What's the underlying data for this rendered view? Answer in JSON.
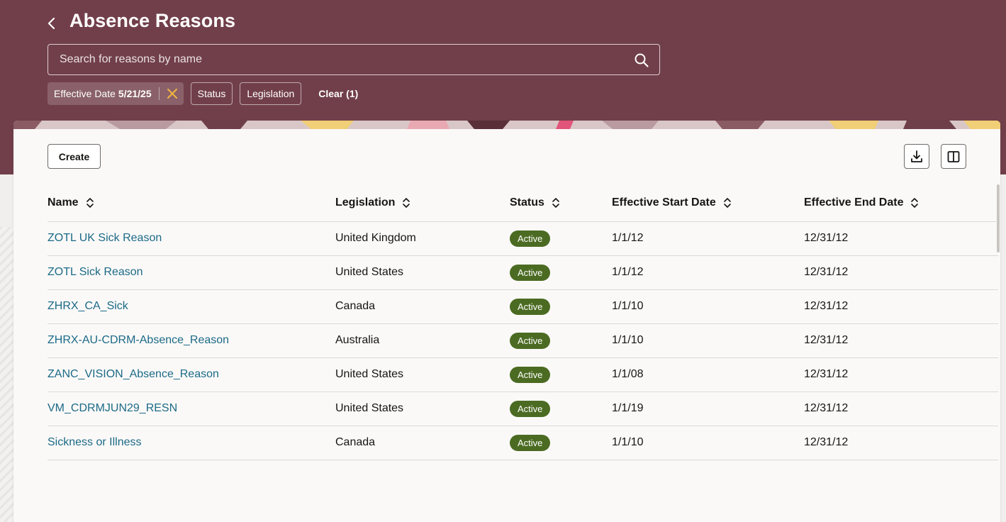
{
  "header": {
    "title": "Absence Reasons",
    "search_placeholder": "Search for reasons by name",
    "filters": {
      "effective_date_label": "Effective Date",
      "effective_date_value": "5/21/25",
      "status_label": "Status",
      "legislation_label": "Legislation",
      "clear_label": "Clear (1)"
    }
  },
  "toolbar": {
    "create_label": "Create",
    "download_icon": "download-icon",
    "columns_icon": "column-panel-icon"
  },
  "table": {
    "columns": [
      "Name",
      "Legislation",
      "Status",
      "Effective Start Date",
      "Effective End Date"
    ],
    "rows": [
      {
        "name": "ZOTL UK Sick Reason",
        "legislation": "United Kingdom",
        "status": "Active",
        "start": "1/1/12",
        "end": "12/31/12"
      },
      {
        "name": "ZOTL Sick Reason",
        "legislation": "United States",
        "status": "Active",
        "start": "1/1/12",
        "end": "12/31/12"
      },
      {
        "name": "ZHRX_CA_Sick",
        "legislation": "Canada",
        "status": "Active",
        "start": "1/1/10",
        "end": "12/31/12"
      },
      {
        "name": "ZHRX-AU-CDRM-Absence_Reason",
        "legislation": "Australia",
        "status": "Active",
        "start": "1/1/10",
        "end": "12/31/12"
      },
      {
        "name": "ZANC_VISION_Absence_Reason",
        "legislation": "United States",
        "status": "Active",
        "start": "1/1/08",
        "end": "12/31/12"
      },
      {
        "name": "VM_CDRMJUN29_RESN",
        "legislation": "United States",
        "status": "Active",
        "start": "1/1/19",
        "end": "12/31/12"
      },
      {
        "name": "Sickness or Illness",
        "legislation": "Canada",
        "status": "Active",
        "start": "1/1/10",
        "end": "12/31/12"
      }
    ]
  },
  "colors": {
    "header_bg": "#713f4a",
    "link": "#1b6a86",
    "active_badge": "#4b6b22",
    "chip_close": "#f2b53f"
  }
}
